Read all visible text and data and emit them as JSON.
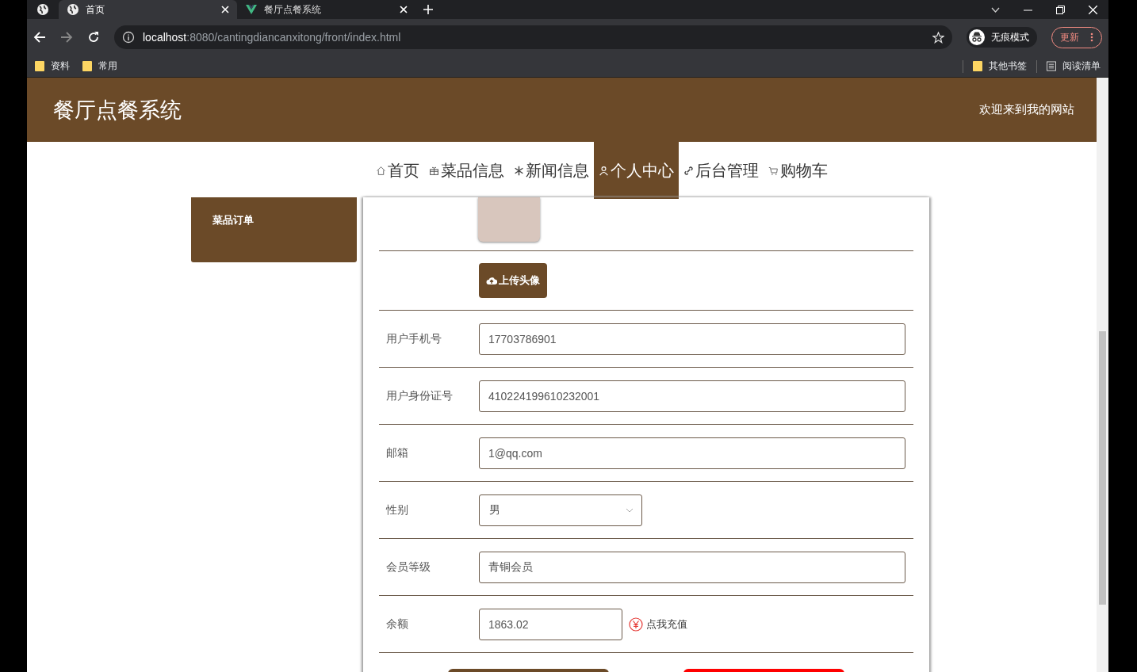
{
  "browser": {
    "tabs": [
      {
        "title": "首页",
        "selected": true,
        "kind": "globe"
      },
      {
        "title": "餐厅点餐系统",
        "selected": false,
        "kind": "vue"
      }
    ],
    "url_host": "localhost",
    "url_rest": ":8080/cantingdiancanxitong/front/index.html",
    "incognito": "无痕模式",
    "update": "更新",
    "bookmarks": [
      "资料",
      "常用"
    ],
    "other_bookmarks": "其他书签",
    "reading_list": "阅读清单"
  },
  "site": {
    "title": "餐厅点餐系统",
    "welcome": "欢迎来到我的网站",
    "nav": [
      {
        "label": "首页",
        "kind": "home",
        "selected": false
      },
      {
        "label": "菜品信息",
        "kind": "gift",
        "selected": false
      },
      {
        "label": "新闻信息",
        "kind": "snow",
        "selected": false
      },
      {
        "label": "个人中心",
        "kind": "user",
        "selected": true
      },
      {
        "label": "后台管理",
        "kind": "link",
        "selected": false
      },
      {
        "label": "购物车",
        "kind": "cart",
        "selected": false
      }
    ],
    "sidebar": [
      {
        "label": "菜品订单"
      }
    ],
    "form": [
      {
        "kind": "avatar"
      },
      {
        "kind": "upload",
        "button": "上传头像"
      },
      {
        "kind": "text",
        "label": "用户手机号",
        "value": "17703786901"
      },
      {
        "kind": "text",
        "label": "用户身份证号",
        "value": "410224199610232001"
      },
      {
        "kind": "text",
        "label": "邮箱",
        "value": "1@qq.com"
      },
      {
        "kind": "select",
        "label": "性别",
        "value": "男"
      },
      {
        "kind": "text",
        "label": "会员等级",
        "value": "青铜会员"
      },
      {
        "kind": "balance",
        "label": "余额",
        "value": "1863.02",
        "link": "点我充值"
      }
    ],
    "buttons": [
      {
        "kind": "primary"
      },
      {
        "kind": "danger"
      }
    ]
  }
}
